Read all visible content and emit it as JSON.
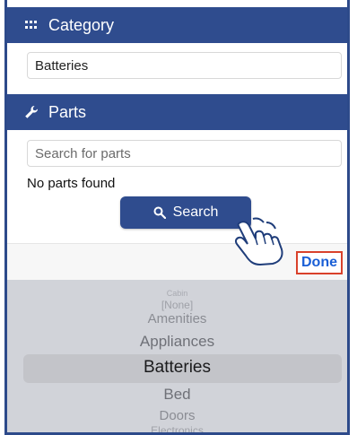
{
  "category": {
    "header_label": "Category",
    "header_icon": "grid-icon",
    "value": "Batteries"
  },
  "parts": {
    "header_label": "Parts",
    "header_icon": "wrench-icon",
    "search_placeholder": "Search for parts",
    "empty_message": "No parts found",
    "search_button_label": "Search",
    "search_button_icon": "magnifier-icon"
  },
  "toolbar": {
    "done_label": "Done"
  },
  "picker": {
    "options": [
      "Cabin",
      "[None]",
      "Amenities",
      "Appliances",
      "Batteries",
      "Bed",
      "Doors",
      "Electronics"
    ],
    "selected": "Batteries"
  },
  "colors": {
    "header_bg": "#2f4c8e",
    "done_text": "#1a5fd6",
    "done_highlight": "#d9412b",
    "picker_bg": "#d1d3d9"
  }
}
